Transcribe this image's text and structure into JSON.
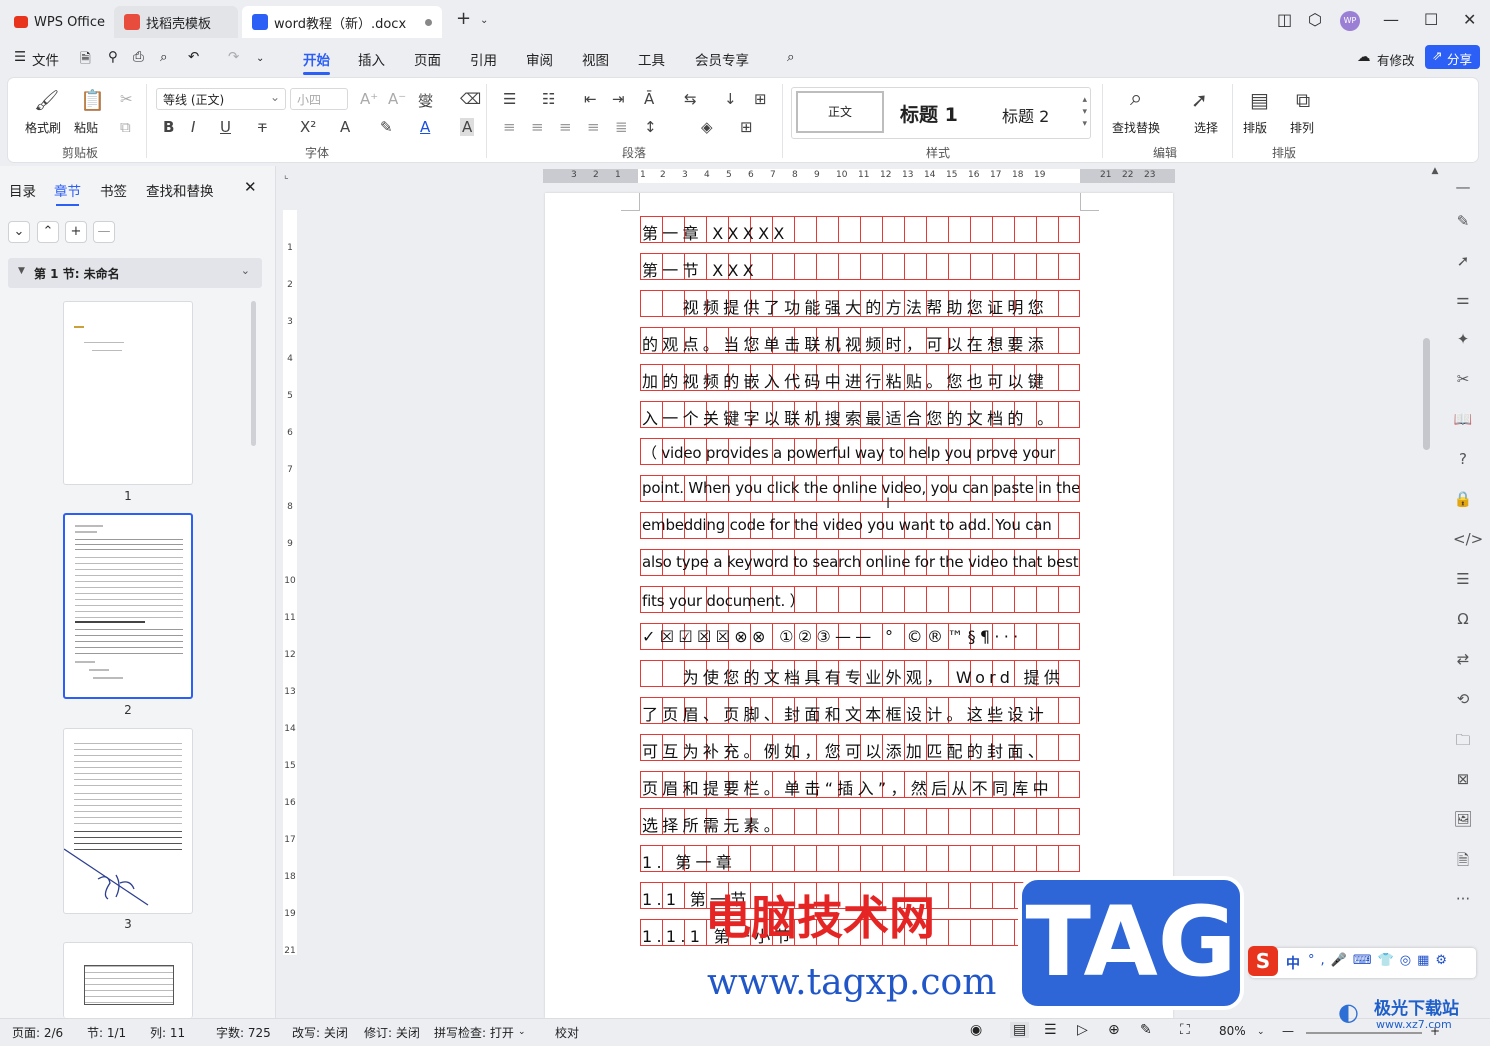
{
  "tabs": [
    {
      "label": "WPS Office"
    },
    {
      "label": "找稻壳模板"
    },
    {
      "label": "word教程（新）.docx"
    }
  ],
  "menu": {
    "file": "文件",
    "items": [
      "开始",
      "插入",
      "页面",
      "引用",
      "审阅",
      "视图",
      "工具",
      "会员专享"
    ],
    "modified": "有修改",
    "share": "分享"
  },
  "ribbon": {
    "clipboard": {
      "format_painter": "格式刷",
      "paste": "粘贴",
      "label": "剪贴板"
    },
    "font": {
      "name": "等线 (正文)",
      "size": "小四",
      "label": "字体"
    },
    "paragraph": {
      "label": "段落"
    },
    "styles": {
      "normal": "正文",
      "h1": "标题 1",
      "h2": "标题 2",
      "label": "样式"
    },
    "edit": {
      "find": "查找替换",
      "select": "选择",
      "label": "编辑"
    },
    "layout": {
      "typeset": "排版",
      "arrange": "排列",
      "label": "排版"
    }
  },
  "leftpanel": {
    "tabs": [
      "目录",
      "章节",
      "书签",
      "查找和替换"
    ],
    "section": "第 1 节: 未命名",
    "pages": [
      "1",
      "2",
      "3"
    ]
  },
  "hruler": [
    "3",
    "2",
    "1",
    "1",
    "2",
    "3",
    "4",
    "5",
    "6",
    "7",
    "8",
    "9",
    "10",
    "11",
    "12",
    "13",
    "14",
    "15",
    "16",
    "17",
    "18",
    "19",
    "21",
    "22",
    "23"
  ],
  "vruler": [
    "1",
    "2",
    "3",
    "4",
    "5",
    "6",
    "7",
    "8",
    "9",
    "10",
    "11",
    "12",
    "13",
    "14",
    "15",
    "16",
    "17",
    "18",
    "19",
    "21"
  ],
  "document": {
    "lines": [
      "第一章 XXXXX",
      "第一节 XXX",
      "　　视频提供了功能强大的方法帮助您证明您",
      "的观点。当您单击联机视频时，可以在想要添",
      "加的视频的嵌入代码中进行粘贴。您也可以键",
      "入一个关键字以联机搜索最适合您的文档的 。",
      "（ video provides a powerful way to help you prove your",
      "point. When you click the online video, you can paste in the",
      "embedding code for the video you want to add. You can",
      "also type a keyword to search online for the video that best",
      "fits your document. ）",
      "✓☒☑☒☒⊗⊗  ①②③——   °  ©®™§¶···",
      "　　为使您的文档具有专业外观， Word 提供",
      "了页眉、页脚、封面和文本框设计。这些设计",
      "可互为补充。例如，您可以添加匹配的封面、",
      "页眉和提要栏。单击“插入”，然后从不同库中",
      "选择所需元素。",
      "1.  第一章",
      "  1.1  第一节",
      "    1.1.1  第一小节"
    ]
  },
  "status": {
    "page": "页面: 2/6",
    "section": "节: 1/1",
    "col": "列: 11",
    "words": "字数: 725",
    "rev_mode": "改写: 关闭",
    "track": "修订: 关闭",
    "spell": "拼写检查: 打开",
    "proof": "校对",
    "zoom": "80%"
  },
  "watermarks": {
    "site_cn": "电脑技术网",
    "site_url": "www.tagxp.com",
    "tag": "TAG",
    "corner": "极光下载站",
    "corner_url": "www.xz7.com"
  },
  "ime": {
    "mode": "中"
  }
}
